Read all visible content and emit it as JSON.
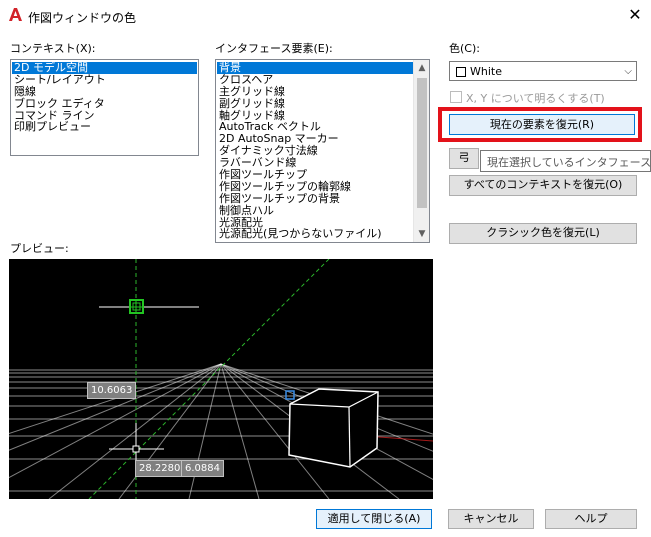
{
  "window": {
    "title": "作図ウィンドウの色",
    "close_glyph": "✕"
  },
  "contexts": {
    "label": "コンテキスト(X):",
    "items": [
      "2D モデル空間",
      "シート/レイアウト",
      "隠線",
      "ブロック エディタ",
      "コマンド ライン",
      "印刷プレビュー"
    ],
    "selected_index": 0
  },
  "interface": {
    "label": "インタフェース要素(E):",
    "items": [
      "背景",
      "クロスヘア",
      "主グリッド線",
      "副グリッド線",
      "軸グリッド線",
      "AutoTrack ベクトル",
      "2D AutoSnap マーカー",
      "ダイナミック寸法線",
      "ラバーバンド線",
      "作図ツールチップ",
      "作図ツールチップの輪郭線",
      "作図ツールチップの背景",
      "制御点ハル",
      "光源配光",
      "光源配光(見つからないファイル)"
    ],
    "selected_index": 0
  },
  "color": {
    "label": "色(C):",
    "value": "White",
    "swatch": "#ffffff",
    "tint_label": "X, Y について明るくする(T)"
  },
  "buttons": {
    "restore_current": "現在の要素を復元(R)",
    "restore_context_partial": "弓",
    "restore_all": "すべてのコンテキストを復元(O)",
    "restore_classic": "クラシック色を復元(L)",
    "apply_close": "適用して閉じる(A)",
    "cancel": "キャンセル",
    "help": "ヘルプ"
  },
  "tooltip": {
    "text": "現在選択しているインタフェース要素"
  },
  "preview": {
    "label": "プレビュー:",
    "dim_top": "10.6063",
    "dim_left": "28.2280",
    "dim_right": "6.0884"
  },
  "colors": {
    "highlight": "#e3121a",
    "selection": "#0078d7",
    "cad_app_icon": "#d2232a"
  }
}
